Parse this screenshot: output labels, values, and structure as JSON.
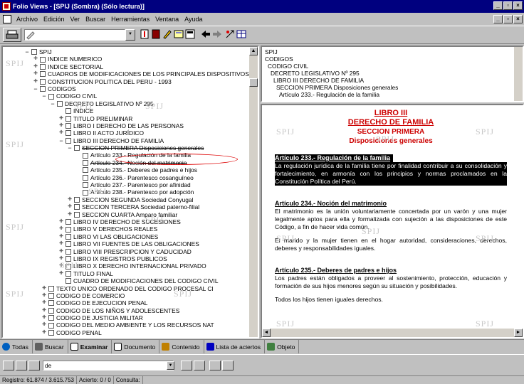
{
  "window": {
    "title": "Folio Views - [SPIJ (Sombra)  (Sólo lectura)]"
  },
  "menu": {
    "items": [
      "Archivo",
      "Edición",
      "Ver",
      "Buscar",
      "Herramientas",
      "Ventana",
      "Ayuda"
    ]
  },
  "tree": {
    "items": [
      {
        "indent": 0,
        "exp": "minus",
        "label": "SPIJ",
        "strike": false
      },
      {
        "indent": 1,
        "exp": "plus",
        "label": "INDICE NUMERICO",
        "strike": false
      },
      {
        "indent": 1,
        "exp": "plus",
        "label": "INDICE SECTORIAL",
        "strike": false
      },
      {
        "indent": 1,
        "exp": "plus",
        "label": "CUADROS DE MODIFICACIONES DE LOS PRINCIPALES DISPOSITIVOS",
        "strike": false
      },
      {
        "indent": 1,
        "exp": "plus",
        "label": "CONSTITUCION POLITICA DEL PERU - 1993",
        "strike": false
      },
      {
        "indent": 1,
        "exp": "minus",
        "label": "CODIGOS",
        "strike": false
      },
      {
        "indent": 2,
        "exp": "minus",
        "label": "CODIGO CIVIL",
        "strike": false
      },
      {
        "indent": 3,
        "exp": "minus",
        "label": "DECRETO LEGISLATIVO Nº 295",
        "strike": false
      },
      {
        "indent": 4,
        "exp": "none",
        "label": "INDICE",
        "strike": false
      },
      {
        "indent": 4,
        "exp": "plus",
        "label": "TITULO PRELIMINAR",
        "strike": false
      },
      {
        "indent": 4,
        "exp": "plus",
        "label": "LIBRO I DERECHO DE LAS PERSONAS",
        "strike": false
      },
      {
        "indent": 4,
        "exp": "plus",
        "label": "LIBRO II ACTO JURÍDICO",
        "strike": false
      },
      {
        "indent": 4,
        "exp": "minus",
        "label": "LIBRO III DERECHO DE FAMILIA",
        "strike": false
      },
      {
        "indent": 5,
        "exp": "minus",
        "label": "SECCION PRIMERA Disposiciones generales",
        "strike": true
      },
      {
        "indent": 6,
        "exp": "none",
        "label": "Artículo 233.- Regulación de la familia",
        "strike": false
      },
      {
        "indent": 6,
        "exp": "none",
        "label": "Artículo 234.- Noción del matrimonio",
        "strike": true
      },
      {
        "indent": 6,
        "exp": "none",
        "label": "Artículo 235.- Deberes de padres e hijos",
        "strike": false
      },
      {
        "indent": 6,
        "exp": "none",
        "label": "Artículo 236.- Parentesco cosanguíneo",
        "strike": false
      },
      {
        "indent": 6,
        "exp": "none",
        "label": "Artículo 237.- Parentesco por afinidad",
        "strike": false
      },
      {
        "indent": 6,
        "exp": "none",
        "label": "Artículo 238.- Parentesco por adopción",
        "strike": false
      },
      {
        "indent": 5,
        "exp": "plus",
        "label": "SECCION SEGUNDA Sociedad Conyugal",
        "strike": false
      },
      {
        "indent": 5,
        "exp": "plus",
        "label": "SECCION TERCERA Sociedad paterno-filial",
        "strike": false
      },
      {
        "indent": 5,
        "exp": "plus",
        "label": "SECCION CUARTA Amparo familiar",
        "strike": false
      },
      {
        "indent": 4,
        "exp": "plus",
        "label": "LIBRO IV DERECHO DE SUCESIONES",
        "strike": false
      },
      {
        "indent": 4,
        "exp": "plus",
        "label": "LIBRO V DERECHOS REALES",
        "strike": false
      },
      {
        "indent": 4,
        "exp": "plus",
        "label": "LIBRO VI LAS OBLIGACIONES",
        "strike": false
      },
      {
        "indent": 4,
        "exp": "plus",
        "label": "LIBRO VII FUENTES DE LAS OBLIGACIONES",
        "strike": false
      },
      {
        "indent": 4,
        "exp": "plus",
        "label": "LIBRO VIII PRESCRIPCION Y CADUCIDAD",
        "strike": false
      },
      {
        "indent": 4,
        "exp": "plus",
        "label": "LIBRO IX REGISTROS PUBLICOS",
        "strike": false
      },
      {
        "indent": 4,
        "exp": "plus",
        "label": "LIBRO X DERECHO INTERNACIONAL PRIVADO",
        "strike": false
      },
      {
        "indent": 4,
        "exp": "plus",
        "label": "TITULO  FINAL",
        "strike": false
      },
      {
        "indent": 4,
        "exp": "none",
        "label": "CUADRO DE MODIFICACIONES DEL CODIGO CIVIL",
        "strike": false
      },
      {
        "indent": 2,
        "exp": "plus",
        "label": "TEXTO UNICO ORDENADO DEL CODIGO PROCESAL CI",
        "strike": false
      },
      {
        "indent": 2,
        "exp": "plus",
        "label": "CODIGO DE COMERCIO",
        "strike": false
      },
      {
        "indent": 2,
        "exp": "plus",
        "label": "CODIGO DE EJECUCION PENAL",
        "strike": false
      },
      {
        "indent": 2,
        "exp": "plus",
        "label": "CODIGO DE LOS NIÑOS Y ADOLESCENTES",
        "strike": false
      },
      {
        "indent": 2,
        "exp": "plus",
        "label": "CODIGO DE JUSTICIA MILITAR",
        "strike": false
      },
      {
        "indent": 2,
        "exp": "plus",
        "label": "CODIGO DEL MEDIO AMBIENTE Y LOS RECURSOS NAT",
        "strike": false
      },
      {
        "indent": 2,
        "exp": "plus",
        "label": "CODIGO PENAL",
        "strike": false
      }
    ]
  },
  "outline": {
    "lines": [
      "SPIJ",
      "CODIGOS",
      "CODIGO CIVIL",
      "DECRETO LEGISLATIVO Nº 295",
      "LIBRO III DERECHO DE FAMILIA",
      "SECCION PRIMERA Disposiciones generales",
      "Artículo 233.- Regulación de la familia"
    ]
  },
  "document": {
    "heading1": "LIBRO III",
    "heading2": "DERECHO DE FAMILIA",
    "heading3": "SECCION PRIMERA",
    "heading4": "Disposiciones generales",
    "art233_title": "Artículo 233.- Regulación de la familia",
    "art233_text": "La regulación jurídica de la familia tiene por finalidad contribuir a su consolidación y fortalecimiento, en armonía con los principios y normas proclamados en la Constitución Política del Perú.",
    "art234_title": "Artículo 234.- Noción del matrimonio",
    "art234_text1": "El matrimonio es la unión voluntariamente concertada por un varón y una mujer legalmente aptos para ella y formalizada con sujeción a las disposiciones de este Código, a fin de hacer vida común.",
    "art234_text2": "El marido y la mujer tienen en el hogar autoridad, consideraciones, derechos, deberes y responsabilidades iguales.",
    "art235_title": "Artículo 235.- Deberes de padres e hijos",
    "art235_text1": "Los padres están obligados a proveer al sostenimiento, protección, educación y formación de sus hijos menores según su situación y posibilidades.",
    "art235_text2": "Todos los hijos tienen iguales derechos.",
    "watermark": "SPIJ"
  },
  "tabs": {
    "todas": "Todas",
    "buscar": "Buscar",
    "examinar": "Examinar",
    "documento": "Documento",
    "contenido": "Contenido",
    "aciertos": "Lista de aciertos",
    "objeto": "Objeto"
  },
  "query": {
    "value": "de"
  },
  "status": {
    "registro": "Registro: 61.874 / 3.615.753",
    "acierto": "Acierto: 0 / 0",
    "consulta": "Consulta:"
  },
  "colors": {
    "titlebar": "#00007f",
    "heading": "#cc0000",
    "selection": "#000000",
    "highlight_circle": "#dd0000"
  }
}
